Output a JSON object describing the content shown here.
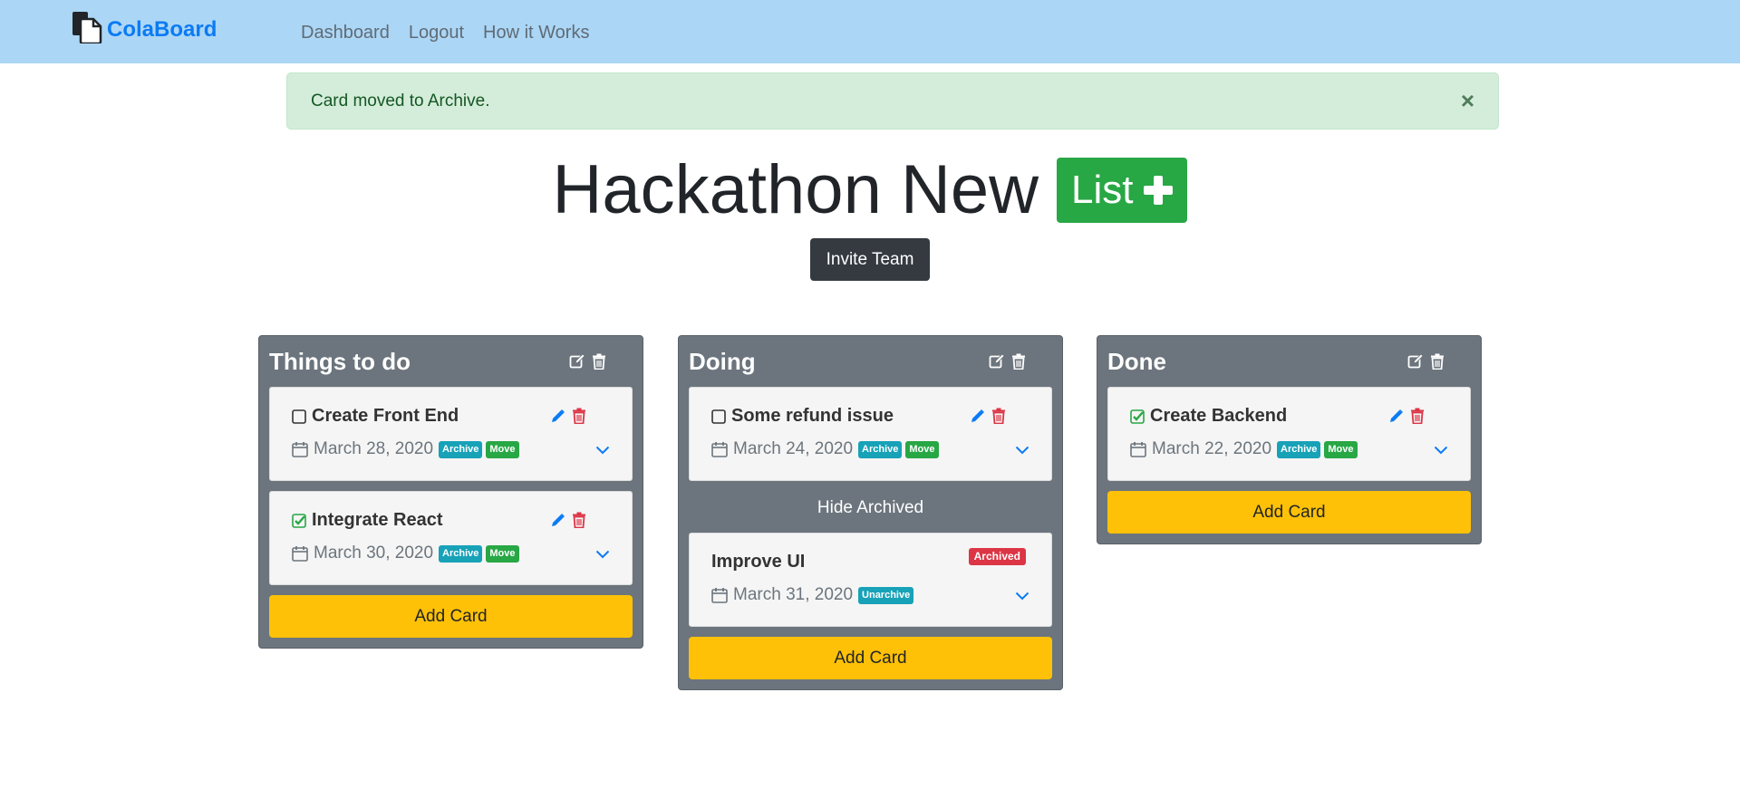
{
  "nav": {
    "brand": "ColaBoard",
    "links": [
      "Dashboard",
      "Logout",
      "How it Works"
    ]
  },
  "alert": {
    "message": "Card moved to Archive.",
    "close": "×"
  },
  "board": {
    "title": "Hackathon New",
    "list_button": "List",
    "invite_button": "Invite Team"
  },
  "lists": [
    {
      "title": "Things to do",
      "cards": [
        {
          "title": "Create Front End",
          "date": "March 28, 2020",
          "checked": false,
          "archive": "Archive",
          "move": "Move"
        },
        {
          "title": "Integrate React",
          "date": "March 30, 2020",
          "checked": true,
          "archive": "Archive",
          "move": "Move"
        }
      ],
      "add_card": "Add Card"
    },
    {
      "title": "Doing",
      "cards": [
        {
          "title": "Some refund issue",
          "date": "March 24, 2020",
          "checked": false,
          "archive": "Archive",
          "move": "Move"
        }
      ],
      "hide_archived": "Hide Archived",
      "archived_cards": [
        {
          "title": "Improve UI",
          "date": "March 31, 2020",
          "status": "Archived",
          "unarchive": "Unarchive"
        }
      ],
      "add_card": "Add Card"
    },
    {
      "title": "Done",
      "cards": [
        {
          "title": "Create Backend",
          "date": "March 22, 2020",
          "checked": true,
          "archive": "Archive",
          "move": "Move"
        }
      ],
      "add_card": "Add Card"
    }
  ],
  "colors": {
    "navbar": "#acd6f5",
    "brand": "#0b7bf5",
    "list_bg": "#6c757d",
    "add_card": "#ffc107",
    "success": "#28a745",
    "info": "#17a2b8",
    "danger": "#dc3545"
  }
}
